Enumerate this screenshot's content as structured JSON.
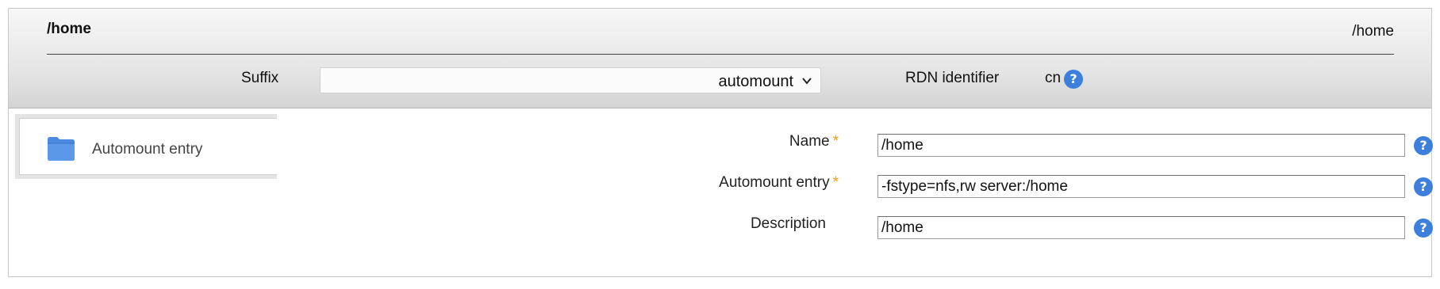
{
  "header": {
    "title": "/home",
    "title_right": "/home",
    "suffix_label": "Suffix",
    "suffix_value": "automount",
    "rdn_label": "RDN identifier",
    "rdn_value": "cn"
  },
  "tabs": [
    {
      "label": "Automount entry",
      "icon": "folder-icon"
    }
  ],
  "form": {
    "fields": [
      {
        "label": "Name",
        "required": true,
        "value": "/home"
      },
      {
        "label": "Automount entry",
        "required": true,
        "value": "-fstype=nfs,rw server:/home"
      },
      {
        "label": "Description",
        "required": false,
        "value": "/home"
      }
    ],
    "required_mark": "*",
    "help_glyph": "?"
  },
  "colors": {
    "help_icon": "#3d7fdc",
    "required_star": "#f39c12",
    "folder": "#4a8ae0"
  }
}
